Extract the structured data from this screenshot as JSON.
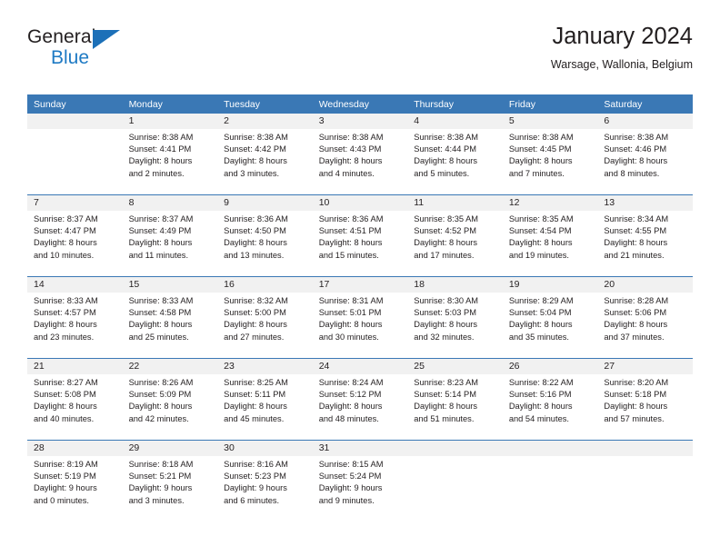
{
  "logo": {
    "word_one": "General",
    "word_two": "Blue",
    "triangle_icon": "triangle-icon",
    "accent_color": "#1c70b8"
  },
  "header": {
    "title": "January 2024",
    "location": "Warsage, Wallonia, Belgium"
  },
  "colors": {
    "header_band": "#3a78b5",
    "daynum_band": "#f1f1f1",
    "text": "#231f20",
    "logo_blue": "#1e7ac4"
  },
  "weekday_headers": [
    "Sunday",
    "Monday",
    "Tuesday",
    "Wednesday",
    "Thursday",
    "Friday",
    "Saturday"
  ],
  "weeks": [
    [
      {
        "day": "",
        "empty": true,
        "sunrise": "",
        "sunset": "",
        "daylight_line1": "",
        "daylight_line2": ""
      },
      {
        "day": "1",
        "sunrise": "Sunrise: 8:38 AM",
        "sunset": "Sunset: 4:41 PM",
        "daylight_line1": "Daylight: 8 hours",
        "daylight_line2": "and 2 minutes."
      },
      {
        "day": "2",
        "sunrise": "Sunrise: 8:38 AM",
        "sunset": "Sunset: 4:42 PM",
        "daylight_line1": "Daylight: 8 hours",
        "daylight_line2": "and 3 minutes."
      },
      {
        "day": "3",
        "sunrise": "Sunrise: 8:38 AM",
        "sunset": "Sunset: 4:43 PM",
        "daylight_line1": "Daylight: 8 hours",
        "daylight_line2": "and 4 minutes."
      },
      {
        "day": "4",
        "sunrise": "Sunrise: 8:38 AM",
        "sunset": "Sunset: 4:44 PM",
        "daylight_line1": "Daylight: 8 hours",
        "daylight_line2": "and 5 minutes."
      },
      {
        "day": "5",
        "sunrise": "Sunrise: 8:38 AM",
        "sunset": "Sunset: 4:45 PM",
        "daylight_line1": "Daylight: 8 hours",
        "daylight_line2": "and 7 minutes."
      },
      {
        "day": "6",
        "sunrise": "Sunrise: 8:38 AM",
        "sunset": "Sunset: 4:46 PM",
        "daylight_line1": "Daylight: 8 hours",
        "daylight_line2": "and 8 minutes."
      }
    ],
    [
      {
        "day": "7",
        "sunrise": "Sunrise: 8:37 AM",
        "sunset": "Sunset: 4:47 PM",
        "daylight_line1": "Daylight: 8 hours",
        "daylight_line2": "and 10 minutes."
      },
      {
        "day": "8",
        "sunrise": "Sunrise: 8:37 AM",
        "sunset": "Sunset: 4:49 PM",
        "daylight_line1": "Daylight: 8 hours",
        "daylight_line2": "and 11 minutes."
      },
      {
        "day": "9",
        "sunrise": "Sunrise: 8:36 AM",
        "sunset": "Sunset: 4:50 PM",
        "daylight_line1": "Daylight: 8 hours",
        "daylight_line2": "and 13 minutes."
      },
      {
        "day": "10",
        "sunrise": "Sunrise: 8:36 AM",
        "sunset": "Sunset: 4:51 PM",
        "daylight_line1": "Daylight: 8 hours",
        "daylight_line2": "and 15 minutes."
      },
      {
        "day": "11",
        "sunrise": "Sunrise: 8:35 AM",
        "sunset": "Sunset: 4:52 PM",
        "daylight_line1": "Daylight: 8 hours",
        "daylight_line2": "and 17 minutes."
      },
      {
        "day": "12",
        "sunrise": "Sunrise: 8:35 AM",
        "sunset": "Sunset: 4:54 PM",
        "daylight_line1": "Daylight: 8 hours",
        "daylight_line2": "and 19 minutes."
      },
      {
        "day": "13",
        "sunrise": "Sunrise: 8:34 AM",
        "sunset": "Sunset: 4:55 PM",
        "daylight_line1": "Daylight: 8 hours",
        "daylight_line2": "and 21 minutes."
      }
    ],
    [
      {
        "day": "14",
        "sunrise": "Sunrise: 8:33 AM",
        "sunset": "Sunset: 4:57 PM",
        "daylight_line1": "Daylight: 8 hours",
        "daylight_line2": "and 23 minutes."
      },
      {
        "day": "15",
        "sunrise": "Sunrise: 8:33 AM",
        "sunset": "Sunset: 4:58 PM",
        "daylight_line1": "Daylight: 8 hours",
        "daylight_line2": "and 25 minutes."
      },
      {
        "day": "16",
        "sunrise": "Sunrise: 8:32 AM",
        "sunset": "Sunset: 5:00 PM",
        "daylight_line1": "Daylight: 8 hours",
        "daylight_line2": "and 27 minutes."
      },
      {
        "day": "17",
        "sunrise": "Sunrise: 8:31 AM",
        "sunset": "Sunset: 5:01 PM",
        "daylight_line1": "Daylight: 8 hours",
        "daylight_line2": "and 30 minutes."
      },
      {
        "day": "18",
        "sunrise": "Sunrise: 8:30 AM",
        "sunset": "Sunset: 5:03 PM",
        "daylight_line1": "Daylight: 8 hours",
        "daylight_line2": "and 32 minutes."
      },
      {
        "day": "19",
        "sunrise": "Sunrise: 8:29 AM",
        "sunset": "Sunset: 5:04 PM",
        "daylight_line1": "Daylight: 8 hours",
        "daylight_line2": "and 35 minutes."
      },
      {
        "day": "20",
        "sunrise": "Sunrise: 8:28 AM",
        "sunset": "Sunset: 5:06 PM",
        "daylight_line1": "Daylight: 8 hours",
        "daylight_line2": "and 37 minutes."
      }
    ],
    [
      {
        "day": "21",
        "sunrise": "Sunrise: 8:27 AM",
        "sunset": "Sunset: 5:08 PM",
        "daylight_line1": "Daylight: 8 hours",
        "daylight_line2": "and 40 minutes."
      },
      {
        "day": "22",
        "sunrise": "Sunrise: 8:26 AM",
        "sunset": "Sunset: 5:09 PM",
        "daylight_line1": "Daylight: 8 hours",
        "daylight_line2": "and 42 minutes."
      },
      {
        "day": "23",
        "sunrise": "Sunrise: 8:25 AM",
        "sunset": "Sunset: 5:11 PM",
        "daylight_line1": "Daylight: 8 hours",
        "daylight_line2": "and 45 minutes."
      },
      {
        "day": "24",
        "sunrise": "Sunrise: 8:24 AM",
        "sunset": "Sunset: 5:12 PM",
        "daylight_line1": "Daylight: 8 hours",
        "daylight_line2": "and 48 minutes."
      },
      {
        "day": "25",
        "sunrise": "Sunrise: 8:23 AM",
        "sunset": "Sunset: 5:14 PM",
        "daylight_line1": "Daylight: 8 hours",
        "daylight_line2": "and 51 minutes."
      },
      {
        "day": "26",
        "sunrise": "Sunrise: 8:22 AM",
        "sunset": "Sunset: 5:16 PM",
        "daylight_line1": "Daylight: 8 hours",
        "daylight_line2": "and 54 minutes."
      },
      {
        "day": "27",
        "sunrise": "Sunrise: 8:20 AM",
        "sunset": "Sunset: 5:18 PM",
        "daylight_line1": "Daylight: 8 hours",
        "daylight_line2": "and 57 minutes."
      }
    ],
    [
      {
        "day": "28",
        "sunrise": "Sunrise: 8:19 AM",
        "sunset": "Sunset: 5:19 PM",
        "daylight_line1": "Daylight: 9 hours",
        "daylight_line2": "and 0 minutes."
      },
      {
        "day": "29",
        "sunrise": "Sunrise: 8:18 AM",
        "sunset": "Sunset: 5:21 PM",
        "daylight_line1": "Daylight: 9 hours",
        "daylight_line2": "and 3 minutes."
      },
      {
        "day": "30",
        "sunrise": "Sunrise: 8:16 AM",
        "sunset": "Sunset: 5:23 PM",
        "daylight_line1": "Daylight: 9 hours",
        "daylight_line2": "and 6 minutes."
      },
      {
        "day": "31",
        "sunrise": "Sunrise: 8:15 AM",
        "sunset": "Sunset: 5:24 PM",
        "daylight_line1": "Daylight: 9 hours",
        "daylight_line2": "and 9 minutes."
      },
      {
        "day": "",
        "empty": true,
        "sunrise": "",
        "sunset": "",
        "daylight_line1": "",
        "daylight_line2": ""
      },
      {
        "day": "",
        "empty": true,
        "sunrise": "",
        "sunset": "",
        "daylight_line1": "",
        "daylight_line2": ""
      },
      {
        "day": "",
        "empty": true,
        "sunrise": "",
        "sunset": "",
        "daylight_line1": "",
        "daylight_line2": ""
      }
    ]
  ]
}
